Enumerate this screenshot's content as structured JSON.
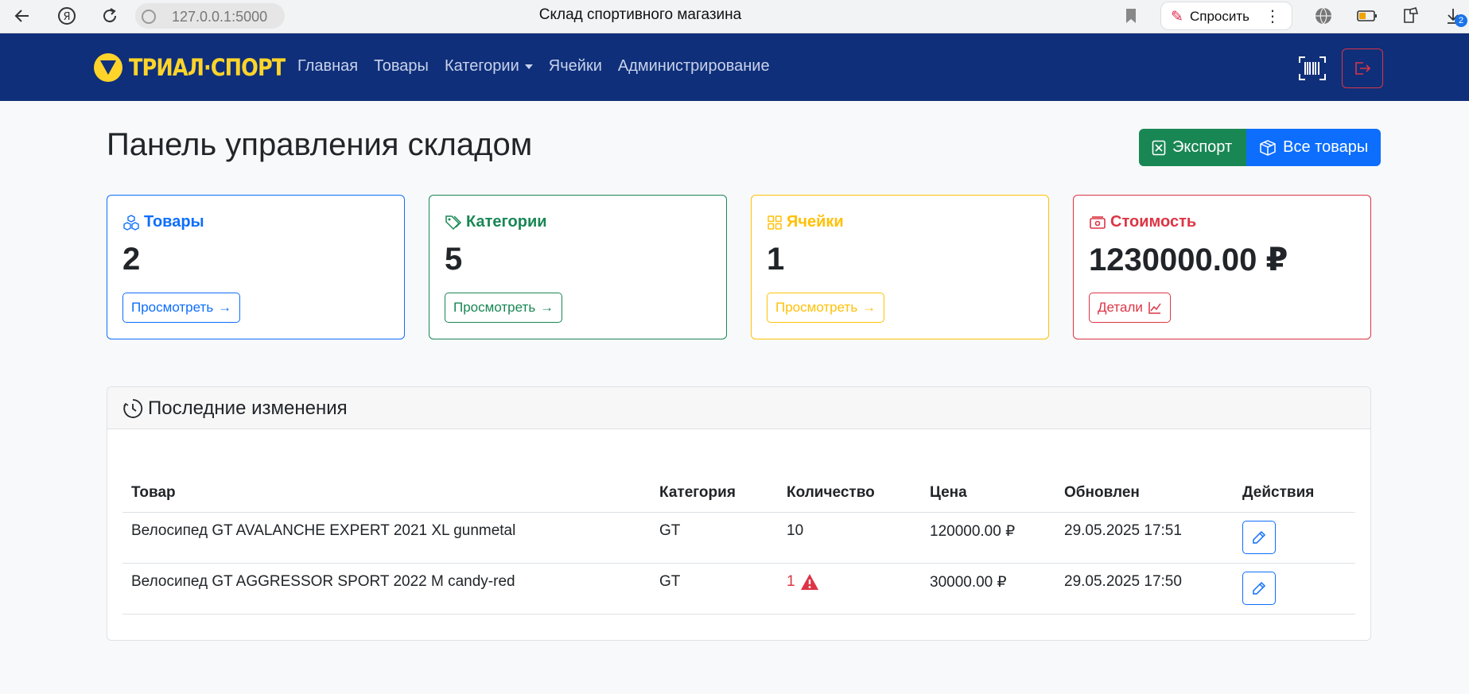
{
  "browser": {
    "url": "127.0.0.1:5000",
    "tab_title": "Склад спортивного магазина",
    "ask_label": "Спросить",
    "downloads_count": "2"
  },
  "navbar": {
    "logo_text": "ТРИАЛ·СПОРТ",
    "links": [
      "Главная",
      "Товары",
      "Категории",
      "Ячейки",
      "Администрирование"
    ]
  },
  "header": {
    "title": "Панель управления складом",
    "export_label": "Экспорт",
    "all_products_label": "Все товары"
  },
  "stats": [
    {
      "title": "Товары",
      "value": "2",
      "button": "Просмотреть",
      "color": "#0d6efd"
    },
    {
      "title": "Категории",
      "value": "5",
      "button": "Просмотреть",
      "color": "#198754"
    },
    {
      "title": "Ячейки",
      "value": "1",
      "button": "Просмотреть",
      "color": "#ffc107"
    },
    {
      "title": "Стоимость",
      "value": "1230000.00 ₽",
      "button": "Детали",
      "color": "#dc3545"
    }
  ],
  "recent": {
    "title": "Последние изменения",
    "columns": [
      "Товар",
      "Категория",
      "Количество",
      "Цена",
      "Обновлен",
      "Действия"
    ],
    "rows": [
      {
        "product": "Велосипед GT AVALANCHE EXPERT 2021 XL gunmetal",
        "category": "GT",
        "quantity": "10",
        "price": "120000.00 ₽",
        "updated": "29.05.2025 17:51",
        "low_stock": false
      },
      {
        "product": "Велосипед GT AGGRESSOR SPORT 2022 M candy-red",
        "category": "GT",
        "quantity": "1",
        "price": "30000.00 ₽",
        "updated": "29.05.2025 17:50",
        "low_stock": true
      }
    ]
  }
}
